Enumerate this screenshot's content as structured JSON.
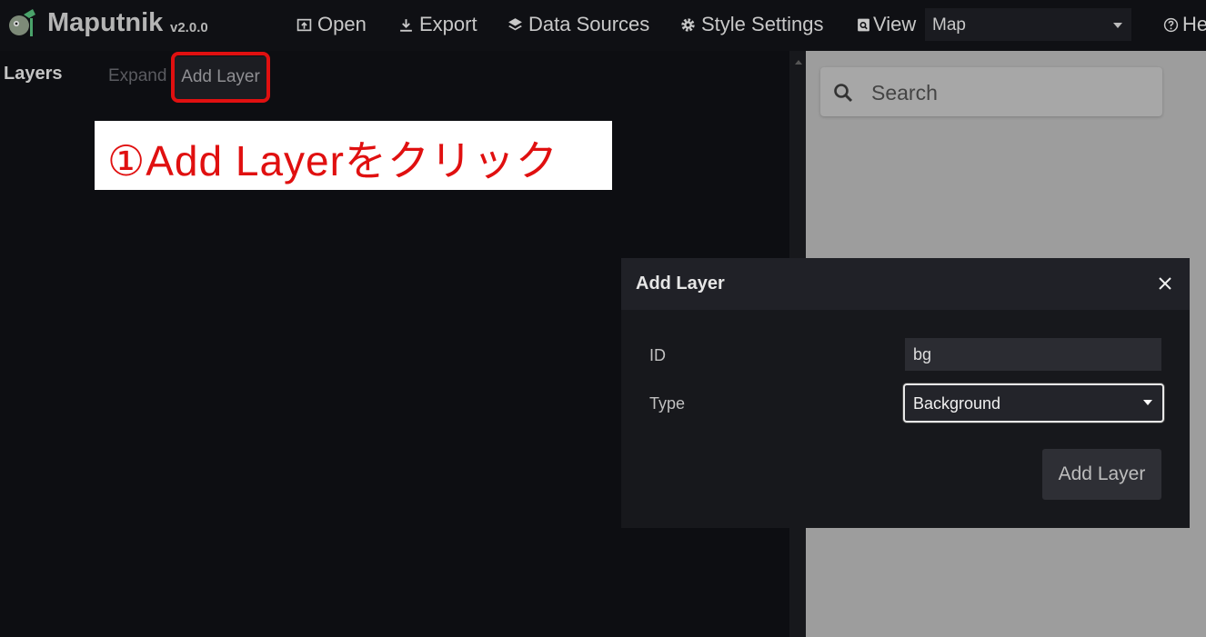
{
  "app": {
    "title": "Maputnik",
    "version": "v2.0.0"
  },
  "nav": {
    "open": "Open",
    "export": "Export",
    "data_sources": "Data Sources",
    "style_settings": "Style Settings",
    "view": "View",
    "view_selected": "Map",
    "help": "He"
  },
  "layers_panel": {
    "title": "Layers",
    "expand_label": "Expand",
    "add_layer_label": "Add Layer"
  },
  "annotation": {
    "text": "①Add Layerをクリック",
    "color": "#e01010"
  },
  "map": {
    "search_placeholder": "Search"
  },
  "modal": {
    "title": "Add Layer",
    "id_label": "ID",
    "id_value": "bg",
    "type_label": "Type",
    "type_value": "Background",
    "submit_label": "Add Layer"
  },
  "icons": {
    "logo": "maputnik-logo-icon",
    "open": "open-icon",
    "export": "download-icon",
    "data_sources": "layers-icon",
    "style_settings": "gear-icon",
    "view": "view-icon",
    "help": "help-icon",
    "search": "search-icon",
    "close": "close-icon"
  }
}
